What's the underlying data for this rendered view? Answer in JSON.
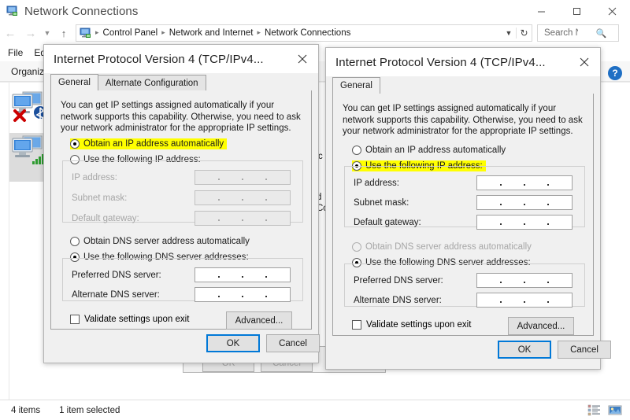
{
  "window": {
    "title": "Network Connections",
    "icon": "network-connections-icon",
    "controls": {
      "minimize": "minimize-icon",
      "maximize": "maximize-icon",
      "close": "close-icon"
    }
  },
  "nav": {
    "back": "back-arrow-icon",
    "forward": "forward-arrow-icon",
    "recent": "recent-locations-icon",
    "up": "up-arrow-icon",
    "breadcrumb": [
      "Control Panel",
      "Network and Internet",
      "Network Connections"
    ],
    "separator": "›",
    "dropdown": "chevron-down-icon",
    "refresh": "refresh-icon"
  },
  "search": {
    "value": "Search N...",
    "icon": "search-icon"
  },
  "menubar": [
    "File",
    "Ed"
  ],
  "toolbar": [
    "Organiz"
  ],
  "background_items": {
    "right_column": [
      "c",
      "d",
      "Co"
    ]
  },
  "status": {
    "items": "4 items",
    "selected": "1 item selected",
    "views": [
      "details-view-icon",
      "large-icons-view-icon"
    ]
  },
  "help": {
    "label": "?",
    "icon": "help-icon"
  },
  "background_dialog": {
    "ok": "OK",
    "cancel": "Cancel"
  },
  "dialog": {
    "title": "Internet Protocol Version 4 (TCP/IPv4...",
    "close": "close-icon",
    "description": "You can get IP settings assigned automatically if your network supports this capability. Otherwise, you need to ask your network administrator for the appropriate IP settings.",
    "ip_auto": "Obtain an IP address automatically",
    "ip_manual": "Use the following IP address:",
    "ip_address": "IP address:",
    "subnet_mask": "Subnet mask:",
    "default_gateway": "Default gateway:",
    "dns_auto": "Obtain DNS server address automatically",
    "dns_manual": "Use the following DNS server addresses:",
    "preferred_dns": "Preferred DNS server:",
    "alternate_dns": "Alternate DNS server:",
    "validate": "Validate settings upon exit",
    "advanced": "Advanced...",
    "ok": "OK",
    "cancel": "Cancel"
  },
  "left_dialog": {
    "tabs": [
      "General",
      "Alternate Configuration"
    ],
    "active_tab": "General",
    "ip_auto_selected": true,
    "ip_manual_selected": false,
    "ip_fields_enabled": false,
    "dns_auto_selected": false,
    "dns_manual_selected": true,
    "dns_auto_disabled": false,
    "highlight": "ip_auto",
    "highlight_color": "#ffff00"
  },
  "right_dialog": {
    "tabs": [
      "General"
    ],
    "active_tab": "General",
    "ip_auto_selected": false,
    "ip_manual_selected": true,
    "ip_fields_enabled": true,
    "dns_auto_selected": false,
    "dns_manual_selected": true,
    "dns_auto_disabled": true,
    "highlight": "ip_manual",
    "highlight_color": "#ffff00"
  }
}
